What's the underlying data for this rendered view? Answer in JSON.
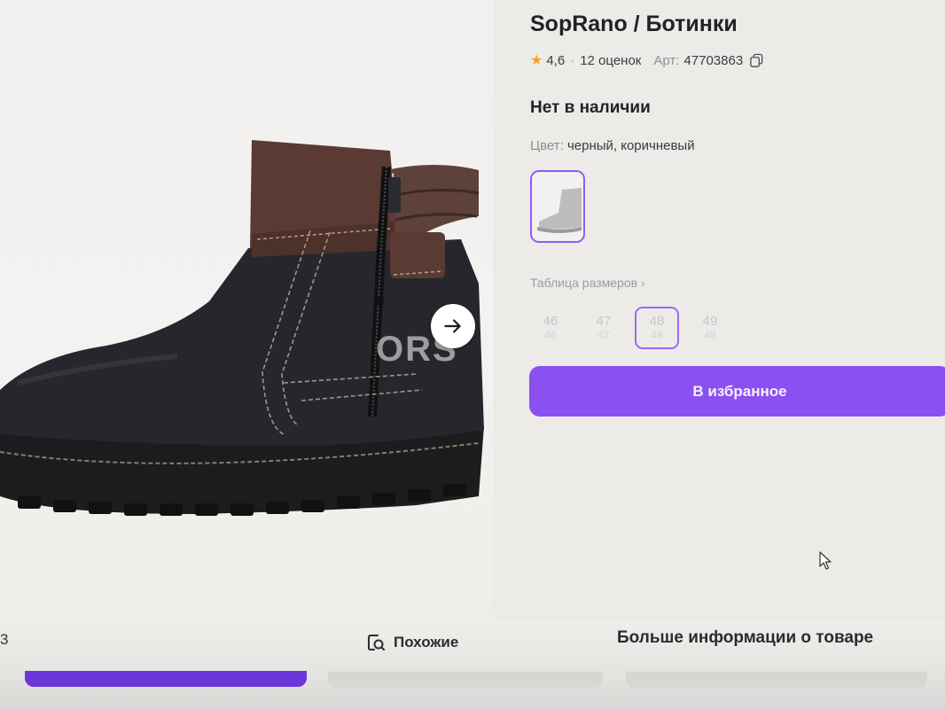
{
  "product": {
    "title": "SopRano / Ботинки",
    "rating": "4,6",
    "reviews": "12 оценок",
    "article_label": "Арт:",
    "article_value": "47703863",
    "availability": "Нет в наличии",
    "color_label": "Цвет:",
    "color_value": "черный, коричневый",
    "size_table_link": "Таблица размеров ›"
  },
  "sizes": [
    {
      "size": "46",
      "ru": "46",
      "selected": false
    },
    {
      "size": "47",
      "ru": "47",
      "selected": false
    },
    {
      "size": "48",
      "ru": "48",
      "selected": true
    },
    {
      "size": "49",
      "ru": "49",
      "selected": false
    }
  ],
  "actions": {
    "favorite_label": "В избранное",
    "similar_label": "Похожие",
    "more_info_label": "Больше информации о товаре"
  },
  "gallery": {
    "watermark": "ORS",
    "edge_digit": "3"
  },
  "icons": {
    "rating_star": "star-icon",
    "copy": "copy-icon",
    "next": "arrow-right-icon",
    "similar": "similar-search-icon"
  },
  "colors": {
    "accent": "#8c4ff0",
    "accent_dark": "#6b35d9",
    "star": "#f2a12a",
    "text": "#232327",
    "muted": "#8f8f99"
  }
}
